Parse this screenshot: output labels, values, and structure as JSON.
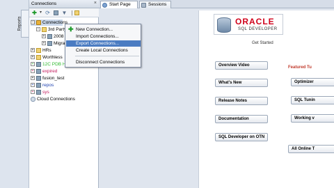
{
  "reports_tab": {
    "label": "Reports"
  },
  "connections_panel": {
    "title": "Connections",
    "tree": [
      {
        "label": "Connections",
        "color": "#000000",
        "selected": true
      },
      {
        "label": "3rd Party",
        "color": "#000000"
      },
      {
        "label": "2008",
        "color": "#000000"
      },
      {
        "label": "Migrat",
        "color": "#000000"
      },
      {
        "label": "HRs",
        "color": "#000000"
      },
      {
        "label": "Worthless",
        "color": "#000000"
      },
      {
        "label": "12C PDB H",
        "color": "#2db82d"
      },
      {
        "label": "expired",
        "color": "#c2185b"
      },
      {
        "label": "fusion_test",
        "color": "#000000"
      },
      {
        "label": "repos",
        "color": "#1a3fb0"
      },
      {
        "label": "sys",
        "color": "#c2185b"
      },
      {
        "label": "Cloud Connections",
        "color": "#000000"
      }
    ]
  },
  "tabs": [
    {
      "label": "Start Page"
    },
    {
      "label": "Sessions"
    }
  ],
  "context_menu": {
    "items": [
      {
        "label": "New Connection...",
        "selected": false
      },
      {
        "label": "Import Connections...",
        "selected": false
      },
      {
        "label": "Export Connections...",
        "selected": true
      },
      {
        "label": "Create Local Connections",
        "selected": false
      },
      {
        "label": "Disconnect Connections",
        "selected": false
      }
    ]
  },
  "start_page": {
    "brand": "ORACLE",
    "product": "SQL DEVELOPER",
    "get_started": "Get Started",
    "buttons": [
      "Overview Video",
      "What's New",
      "Release Notes",
      "Documentation",
      "SQL Developer on OTN"
    ],
    "featured_title": "Featured Tu",
    "featured_buttons": [
      "Optimizer",
      "SQL Tunin",
      "Working v",
      "All Online T"
    ]
  },
  "colors": {
    "accent": "#4b7cc2",
    "brand": "#d0021b",
    "featured": "#c0392b"
  }
}
